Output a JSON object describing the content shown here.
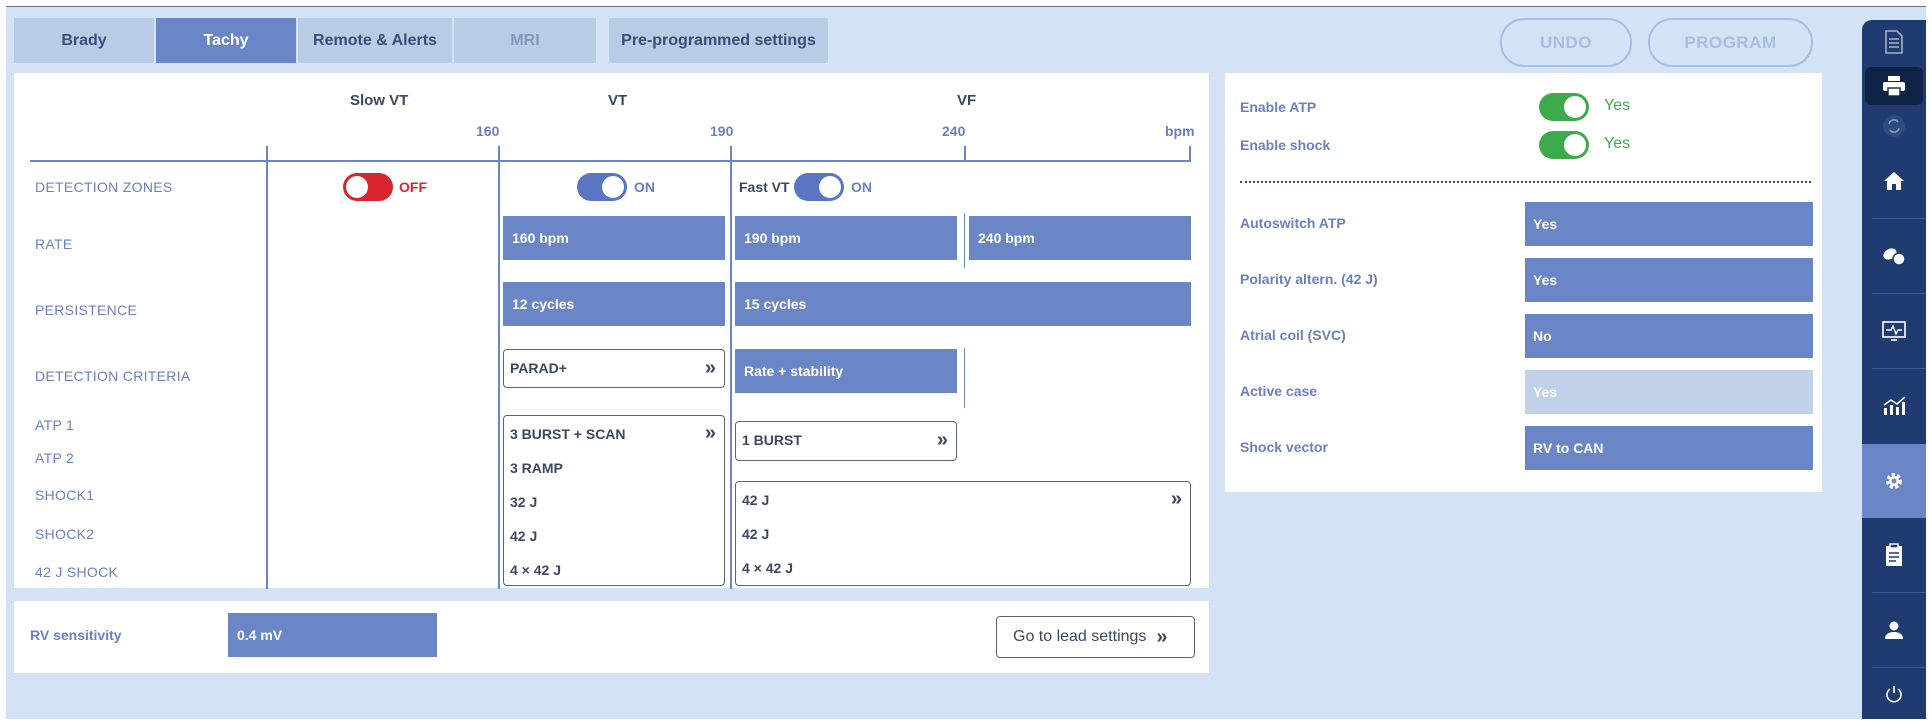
{
  "tabs": [
    {
      "label": "Brady",
      "state": "normal"
    },
    {
      "label": "Tachy",
      "state": "active"
    },
    {
      "label": "Remote & Alerts",
      "state": "normal"
    },
    {
      "label": "MRI",
      "state": "disabled"
    },
    {
      "label": "Pre-programmed settings",
      "state": "normal"
    }
  ],
  "actions": {
    "undo": "UNDO",
    "program": "PROGRAM"
  },
  "zones": {
    "headers": {
      "slow_vt": "Slow VT",
      "vt": "VT",
      "vf": "VF"
    },
    "ticks": {
      "t160": "160",
      "t190": "190",
      "t240": "240",
      "unit": "bpm"
    }
  },
  "rows": {
    "detection_zones": "DETECTION ZONES",
    "rate": "RATE",
    "persistence": "PERSISTENCE",
    "detection_criteria": "DETECTION CRITERIA",
    "atp1": "ATP 1",
    "atp2": "ATP 2",
    "shock1": "SHOCK1",
    "shock2": "SHOCK2",
    "shock42": "42 J SHOCK"
  },
  "toggles": {
    "slow_vt": {
      "label": "OFF",
      "state": "off"
    },
    "vt": {
      "label": "ON",
      "state": "on"
    },
    "fast_vt": {
      "prefix": "Fast VT",
      "label": "ON",
      "state": "on"
    }
  },
  "values": {
    "vt_rate": "160  bpm",
    "fvt_rate": "190  bpm",
    "vf_rate": "240  bpm",
    "vt_persistence": "12  cycles",
    "vf_persistence": "15  cycles",
    "vt_criteria": "PARAD+",
    "fvt_criteria": "Rate + stability",
    "vt_atp1": "3 BURST + SCAN",
    "vt_atp2": "3 RAMP",
    "vt_shock1": "32 J",
    "vt_shock2": "42 J",
    "vt_shock42": "4 × 42 J",
    "fvt_atp1": "1 BURST",
    "vf_shock1": "42 J",
    "vf_shock2": "42 J",
    "vf_shock42": "4 × 42 J"
  },
  "sensitivity": {
    "label": "RV sensitivity",
    "value": "0.4  mV",
    "lead_button": "Go to lead settings"
  },
  "right": {
    "enable_atp": {
      "label": "Enable ATP",
      "value": "Yes"
    },
    "enable_shock": {
      "label": "Enable shock",
      "value": "Yes"
    },
    "items": [
      {
        "label": "Autoswitch ATP",
        "value": "Yes",
        "style": "normal"
      },
      {
        "label": "Polarity altern. (42 J)",
        "value": "Yes",
        "style": "normal"
      },
      {
        "label": "Atrial coil (SVC)",
        "value": "No",
        "style": "normal"
      },
      {
        "label": "Active case",
        "value": "Yes",
        "style": "disabled"
      },
      {
        "label": "Shock vector",
        "value": "RV to CAN",
        "style": "normal"
      }
    ]
  },
  "sidebar": {
    "icons": [
      "document-icon",
      "printer-icon",
      "sync-icon",
      "home-icon",
      "pills-icon",
      "ecg-monitor-icon",
      "trend-chart-icon",
      "gear-icon",
      "clipboard-icon",
      "user-icon",
      "power-icon"
    ],
    "active": "gear-icon"
  },
  "colors": {
    "accent": "#6b86c6",
    "background": "#d3e3f5",
    "toggle_on": "#3dab4a",
    "toggle_off": "#d7262c",
    "sidebar": "#1f3b6f"
  }
}
